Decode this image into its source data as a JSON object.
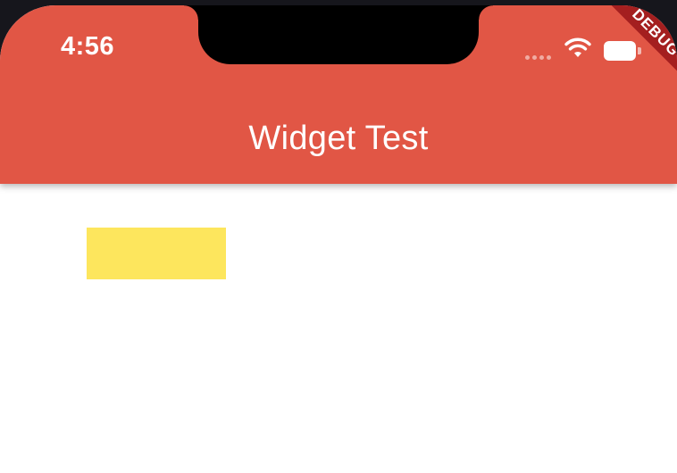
{
  "status_bar": {
    "time": "4:56"
  },
  "app_bar": {
    "title": "Widget Test",
    "color": "#e15645"
  },
  "debug_banner": {
    "label": "DEBUG",
    "color": "#a41f1f"
  },
  "body": {
    "box_color": "#fde65d"
  },
  "icons": [
    "wifi-icon",
    "battery-icon",
    "cellular-signal-icon"
  ]
}
